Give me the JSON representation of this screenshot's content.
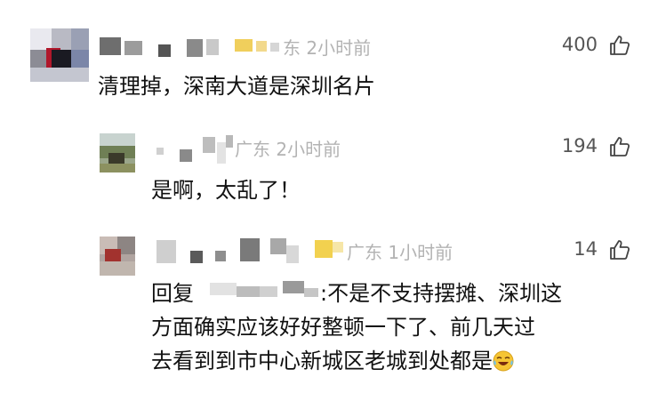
{
  "comments": [
    {
      "location_time": "东 2小时前",
      "likes": "400",
      "text": "清理掉，深南大道是深圳名片"
    },
    {
      "location_time": "广东 2小时前",
      "likes": "194",
      "text": "是啊，太乱了！"
    },
    {
      "location_time": "广东 1小时前",
      "likes": "14",
      "reply_prefix": "回复",
      "text_line1": ":不是不支持摆摊、深圳这",
      "text_line2": "方面确实应该好好整顿一下了、前几天过",
      "text_line3": "去看到到市中心新城区老城到处都是",
      "emoji": "laughing-crying-emoji"
    }
  ],
  "icons": {
    "like": "thumbs-up-icon"
  },
  "colors": {
    "meta_text": "#b3b3b3",
    "body_text": "#111111",
    "likes_text": "#555555"
  }
}
